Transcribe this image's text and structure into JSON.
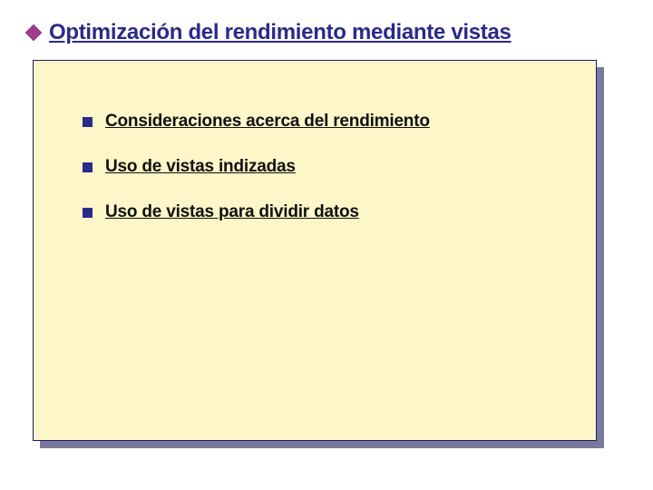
{
  "title": "Optimización del rendimiento mediante vistas",
  "items": [
    {
      "label": "Consideraciones acerca del rendimiento"
    },
    {
      "label": "Uso de vistas indizadas"
    },
    {
      "label": "Uso de vistas para dividir datos"
    }
  ],
  "colors": {
    "accent": "#2a2a8a",
    "panel_bg": "#fdf6c8",
    "panel_border": "#1a1a60",
    "shadow": "#7a7a9e",
    "diamond_fill": "#a23a8f"
  }
}
